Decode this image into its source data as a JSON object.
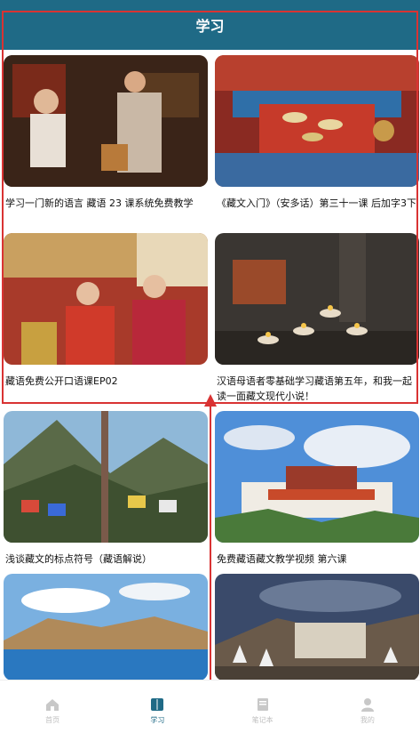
{
  "header": {
    "title": "学习"
  },
  "cards": [
    {
      "caption": "学习一门新的语言 藏语 23 课系统免费教学"
    },
    {
      "caption": "《藏文入门》（安多话）第三十一课 后加字3下"
    },
    {
      "caption": "藏语免费公开口语课EP02"
    },
    {
      "caption": "汉语母语者零基础学习藏语第五年，和我一起读一面藏文现代小说！"
    },
    {
      "caption": "浅谈藏文的标点符号（藏语解说）"
    },
    {
      "caption": "免费藏语藏文教学视频 第六课"
    },
    {
      "caption": ""
    },
    {
      "caption": ""
    }
  ],
  "nav": [
    {
      "label": "首页",
      "icon": "home-icon"
    },
    {
      "label": "学习",
      "icon": "book-icon"
    },
    {
      "label": "笔记本",
      "icon": "notebook-icon"
    },
    {
      "label": "我的",
      "icon": "user-icon"
    }
  ],
  "colors": {
    "header": "#1f6a86",
    "annotation": "#d93333",
    "nav_inactive": "#c0c0c0"
  }
}
